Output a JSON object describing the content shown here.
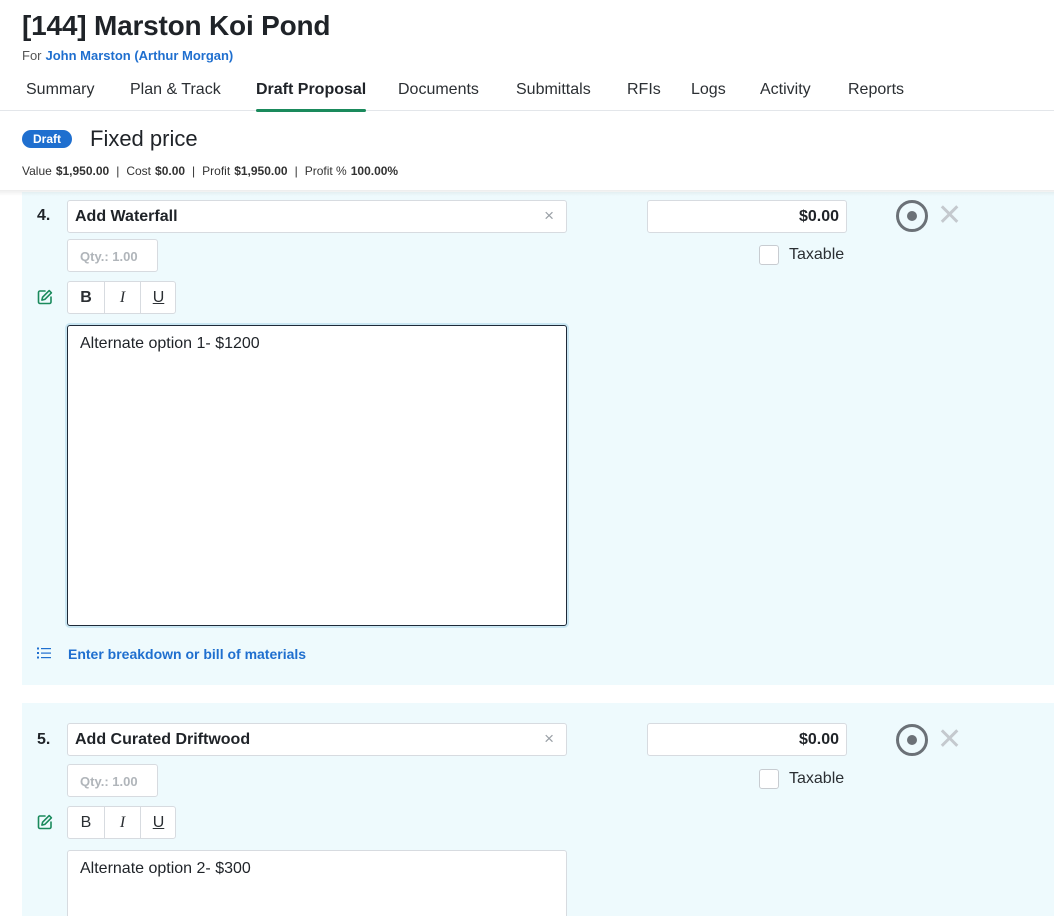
{
  "project": {
    "title": "[144] Marston Koi Pond",
    "client_prefix": "For",
    "client_name": "John Marston (Arthur Morgan)"
  },
  "tabs": [
    {
      "label": "Summary"
    },
    {
      "label": "Plan & Track"
    },
    {
      "label": "Draft Proposal",
      "active": true
    },
    {
      "label": "Documents"
    },
    {
      "label": "Submittals"
    },
    {
      "label": "RFIs"
    },
    {
      "label": "Logs"
    },
    {
      "label": "Activity"
    },
    {
      "label": "Reports"
    }
  ],
  "proposal": {
    "status_badge": "Draft",
    "pricing_type": "Fixed price",
    "stats": {
      "value_label": "Value",
      "value": "$1,950.00",
      "cost_label": "Cost",
      "cost": "$0.00",
      "profit_label": "Profit",
      "profit": "$1,950.00",
      "profit_pct_label": "Profit %",
      "profit_pct": "100.00%"
    }
  },
  "items": [
    {
      "number": "4.",
      "name": "Add Waterfall",
      "price": "$0.00",
      "taxable_label": "Taxable",
      "qty_placeholder": "Qty.: 1.00",
      "description": "Alternate option 1- $1200",
      "breakdown_link": "Enter breakdown or bill of materials"
    },
    {
      "number": "5.",
      "name": "Add Curated Driftwood",
      "price": "$0.00",
      "taxable_label": "Taxable",
      "qty_placeholder": "Qty.: 1.00",
      "description": "Alternate option 2- $300"
    }
  ],
  "format_buttons": {
    "bold": "B",
    "italic": "I",
    "underline": "U"
  },
  "icons": {
    "clear": "×",
    "remove": "✕"
  },
  "colors": {
    "accent_green": "#1a8a5c",
    "link_blue": "#1f6fcf",
    "card_bg": "#eefafd"
  }
}
